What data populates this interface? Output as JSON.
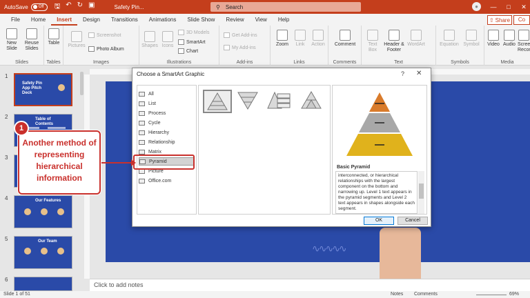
{
  "titlebar": {
    "autosave_label": "AutoSave",
    "autosave_state": "Off",
    "doc_title": "Safety Pin...",
    "search_placeholder": "Search",
    "qat_icons": [
      "save-icon",
      "undo-icon",
      "redo-icon",
      "present-icon"
    ]
  },
  "tabs": [
    {
      "label": "File"
    },
    {
      "label": "Home"
    },
    {
      "label": "Insert"
    },
    {
      "label": "Design"
    },
    {
      "label": "Transitions"
    },
    {
      "label": "Animations"
    },
    {
      "label": "Slide Show"
    },
    {
      "label": "Review"
    },
    {
      "label": "View"
    },
    {
      "label": "Help"
    }
  ],
  "active_tab": "Insert",
  "share_label": "Share",
  "comments_label": "Co",
  "ribbon": {
    "groups": [
      {
        "label": "Slides"
      },
      {
        "label": "Tables"
      },
      {
        "label": "Images"
      },
      {
        "label": "Illustrations"
      },
      {
        "label": "Add-ins"
      },
      {
        "label": "Links"
      },
      {
        "label": "Comments"
      },
      {
        "label": "Text"
      },
      {
        "label": "Symbols"
      },
      {
        "label": "Media"
      }
    ],
    "new_slide": "New Slide",
    "reuse_slides": "Reuse Slides",
    "table": "Table",
    "pictures": "Pictures",
    "screenshot": "Screenshot",
    "photo_album": "Photo Album",
    "shapes": "Shapes",
    "icons": "Icons",
    "models_3d": "3D Models",
    "smartart": "SmartArt",
    "chart": "Chart",
    "get_addins": "Get Add-ins",
    "my_addins": "My Add-ins",
    "zoom": "Zoom",
    "link": "Link",
    "action": "Action",
    "comment": "Comment",
    "text_box": "Text Box",
    "header_footer": "Header & Footer",
    "wordart": "WordArt",
    "equation": "Equation",
    "symbol": "Symbol",
    "video": "Video",
    "audio": "Audio",
    "screen_recording": "Screen Recording"
  },
  "thumbnails": [
    {
      "num": "1",
      "title": "Safety Pin App Pitch Deck"
    },
    {
      "num": "2",
      "title": "Table of Contents"
    },
    {
      "num": "3",
      "title": ""
    },
    {
      "num": "4",
      "title": "Our Features"
    },
    {
      "num": "5",
      "title": "Our Team"
    },
    {
      "num": "6",
      "title": ""
    }
  ],
  "notes_placeholder": "Click to add notes",
  "status": {
    "slide_count": "Slide 1 of 51",
    "notes": "Notes",
    "comments": "Comments",
    "zoom": "69%"
  },
  "dialog": {
    "title": "Choose a SmartArt Graphic",
    "help": "?",
    "close": "✕",
    "categories": [
      {
        "label": "All"
      },
      {
        "label": "List"
      },
      {
        "label": "Process"
      },
      {
        "label": "Cycle"
      },
      {
        "label": "Hierarchy"
      },
      {
        "label": "Relationship"
      },
      {
        "label": "Matrix"
      },
      {
        "label": "Pyramid"
      },
      {
        "label": "Picture"
      },
      {
        "label": "Office.com"
      }
    ],
    "selected_category": "Pyramid",
    "preview_title": "Basic Pyramid",
    "preview_description": "interconnected, or hierarchical relationships with the largest component on the bottom and narrowing up. Level 1 text appears in the pyramid segments and Level 2 text appears in shapes alongside each segment.",
    "ok": "OK",
    "cancel": "Cancel",
    "pyramid_colors": [
      "#d97b2b",
      "#a8a8a8",
      "#e0b21c"
    ]
  },
  "annotation": {
    "badge": "1",
    "text": "Another method of representing hierarchical information",
    "color": "#c9302c"
  }
}
